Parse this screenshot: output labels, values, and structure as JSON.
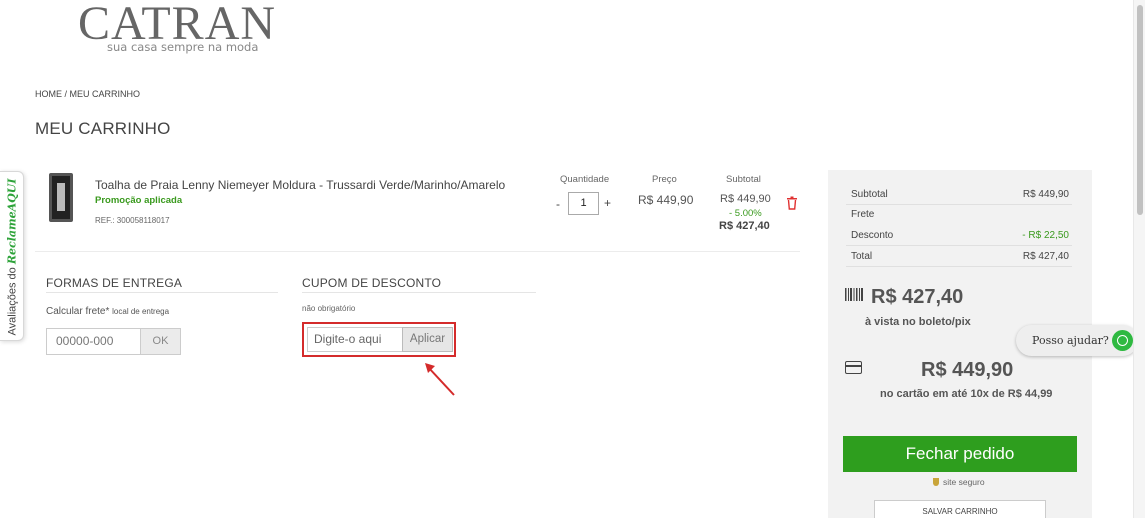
{
  "logo": {
    "name": "CATRAN",
    "tagline": "sua casa sempre na moda"
  },
  "breadcrumb": "HOME / MEU CARRINHO",
  "page_title": "MEU CARRINHO",
  "side_tab": {
    "prefix": "Avaliações do",
    "brand": "ReclameAQUI"
  },
  "cart": {
    "columns": {
      "quantity": "Quantidade",
      "price": "Preço",
      "subtotal": "Subtotal"
    },
    "item": {
      "name": "Toalha de Praia Lenny Niemeyer Moldura - Trussardi Verde/Marinho/Amarelo",
      "promo": "Promoção aplicada",
      "ref": "REF.: 300058118017",
      "qty_minus": "-",
      "quantity": "1",
      "qty_plus": "+",
      "price": "R$ 449,90",
      "subtotal_old": "R$ 449,90",
      "discount_pct": "- 5.00%",
      "subtotal_new": "R$ 427,40"
    }
  },
  "shipping": {
    "title": "FORMAS DE ENTREGA",
    "calc_label": "Calcular frete*",
    "calc_hint": "local de entrega",
    "cep_placeholder": "00000-000",
    "ok_label": "OK"
  },
  "coupon": {
    "title": "CUPOM DE DESCONTO",
    "optional": "não obrigatório",
    "placeholder": "Digite-o aqui",
    "apply_label": "Aplicar"
  },
  "summary": {
    "subtotal_label": "Subtotal",
    "subtotal_value": "R$ 449,90",
    "frete_label": "Frete",
    "desconto_label": "Desconto",
    "desconto_value": "- R$ 22,50",
    "total_label": "Total",
    "total_value": "R$ 427,40",
    "boleto_price": "R$ 427,40",
    "boleto_note": "à vista no boleto/pix",
    "card_price": "R$ 449,90",
    "card_note": "no cartão em até 10x de R$ 44,99",
    "checkout_label": "Fechar pedido",
    "secure_label": "site seguro",
    "save_label": "SALVAR CARRINHO"
  },
  "help": {
    "label": "Posso ajudar?"
  },
  "colors": {
    "accent_green": "#2e9e1e",
    "highlight_red": "#d42b2b",
    "whatsapp": "#2fb941"
  }
}
